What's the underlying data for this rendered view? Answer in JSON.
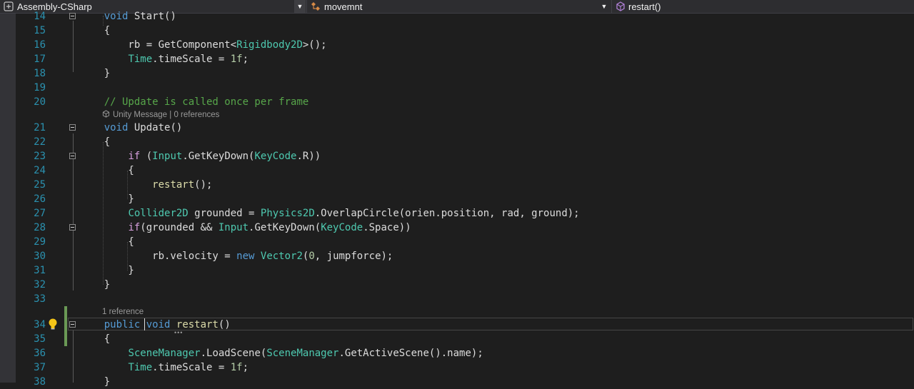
{
  "navbar": {
    "project": "Assembly-CSharp",
    "class_name": "movemnt",
    "member": "restart()",
    "project_icon": "csharp-project-icon",
    "class_icon": "class-icon",
    "member_icon": "method-icon"
  },
  "editor": {
    "lines": [
      {
        "n": "14",
        "text": "    void Start()"
      },
      {
        "n": "15",
        "text": "    {"
      },
      {
        "n": "16",
        "text": "        rb = GetComponent<Rigidbody2D>();"
      },
      {
        "n": "17",
        "text": "        Time.timeScale = 1f;"
      },
      {
        "n": "18",
        "text": "    }"
      },
      {
        "n": "19",
        "text": ""
      },
      {
        "n": "20",
        "text": "    // Update is called once per frame"
      },
      {
        "n": "21",
        "text": "    void Update()"
      },
      {
        "n": "22",
        "text": "    {"
      },
      {
        "n": "23",
        "text": "        if (Input.GetKeyDown(KeyCode.R))"
      },
      {
        "n": "24",
        "text": "        {"
      },
      {
        "n": "25",
        "text": "            restart();"
      },
      {
        "n": "26",
        "text": "        }"
      },
      {
        "n": "27",
        "text": "        Collider2D grounded = Physics2D.OverlapCircle(orien.position, rad, ground);"
      },
      {
        "n": "28",
        "text": "        if(grounded && Input.GetKeyDown(KeyCode.Space))"
      },
      {
        "n": "29",
        "text": "        {"
      },
      {
        "n": "30",
        "text": "            rb.velocity = new Vector2(0, jumpforce);"
      },
      {
        "n": "31",
        "text": "        }"
      },
      {
        "n": "32",
        "text": "    }"
      },
      {
        "n": "33",
        "text": ""
      },
      {
        "n": "34",
        "text": "    public void restart()"
      },
      {
        "n": "35",
        "text": "    {"
      },
      {
        "n": "36",
        "text": "        SceneManager.LoadScene(SceneManager.GetActiveScene().name);"
      },
      {
        "n": "37",
        "text": "        Time.timeScale = 1f;"
      },
      {
        "n": "38",
        "text": "    }"
      }
    ],
    "codelens": {
      "update_message": "Unity Message",
      "update_divider": "|",
      "update_refs": "0 references",
      "restart_refs": "1 reference"
    },
    "colors": {
      "background": "#1e1e1e",
      "keyword": "#569cd6",
      "type": "#4ec9b0",
      "comment": "#57a64a",
      "number": "#b5cea8",
      "method": "#dcdcaa",
      "control": "#d8a0df",
      "line_number": "#2b91af"
    }
  }
}
